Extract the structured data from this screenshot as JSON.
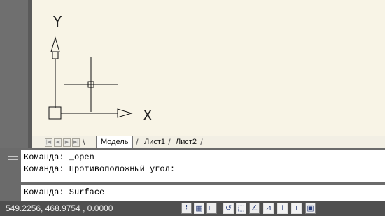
{
  "viewport": {
    "axis_x_label": "X",
    "axis_y_label": "Y"
  },
  "layout_tabs": {
    "nav_buttons": [
      "first-tab-icon",
      "previous-tab-icon",
      "next-tab-icon",
      "last-tab-icon"
    ],
    "tabs": [
      {
        "label": "Модель",
        "active": true
      },
      {
        "label": "Лист1",
        "active": false
      },
      {
        "label": "Лист2",
        "active": false
      }
    ]
  },
  "command_window": {
    "history": [
      "Команда: _open",
      "Команда: Противоположный угол:"
    ],
    "current_input": "Команда: Surface"
  },
  "status_bar": {
    "coordinates": "549.2256, 468.9754 , 0.0000",
    "buttons": [
      {
        "icon": "snap-mode-icon",
        "glyph": "⁞"
      },
      {
        "icon": "grid-display-icon",
        "glyph": "▦"
      },
      {
        "icon": "ortho-mode-icon",
        "glyph": "∟"
      },
      {
        "icon": "polar-tracking-icon",
        "glyph": "↺"
      },
      {
        "icon": "object-snap-icon",
        "glyph": "⬚"
      },
      {
        "icon": "object-snap-tracking-icon",
        "glyph": "∠"
      },
      {
        "icon": "dynamic-ucs-icon",
        "glyph": "⊿"
      },
      {
        "icon": "dynamic-input-icon",
        "glyph": "⊥"
      },
      {
        "icon": "lineweight-icon",
        "glyph": "+"
      },
      {
        "icon": "quick-properties-icon",
        "glyph": "▣"
      }
    ]
  },
  "colors": {
    "drawing_background": "#f8f4e6",
    "chrome_gray": "#6b6b6b",
    "status_bar": "#4f4f4f"
  }
}
